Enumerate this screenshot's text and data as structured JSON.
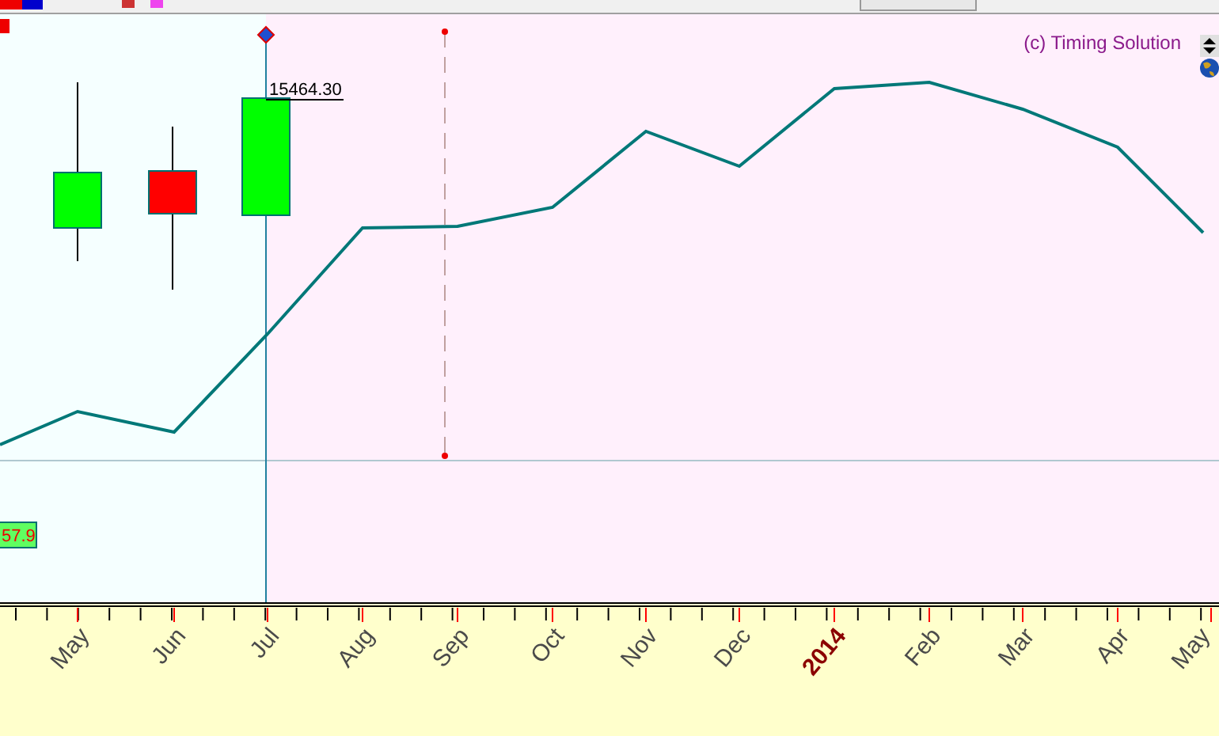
{
  "chart": {
    "copyright": "(c) Timing Solution",
    "price_label": "15464.30",
    "value_marker": "57.9",
    "candles": [
      {
        "color": "#00ff00"
      },
      {
        "color": "#ff0000"
      },
      {
        "color": "#00ff00"
      }
    ],
    "x_axis_labels": [
      {
        "text": "May",
        "kind": "month"
      },
      {
        "text": "Jun",
        "kind": "month"
      },
      {
        "text": "Jul",
        "kind": "month"
      },
      {
        "text": "Aug",
        "kind": "month"
      },
      {
        "text": "Sep",
        "kind": "month"
      },
      {
        "text": "Oct",
        "kind": "month"
      },
      {
        "text": "Nov",
        "kind": "month"
      },
      {
        "text": "Dec",
        "kind": "month"
      },
      {
        "text": "2014",
        "kind": "year"
      },
      {
        "text": "Feb",
        "kind": "month"
      },
      {
        "text": "Mar",
        "kind": "month"
      },
      {
        "text": "Apr",
        "kind": "month"
      },
      {
        "text": "May",
        "kind": "month"
      }
    ]
  }
}
